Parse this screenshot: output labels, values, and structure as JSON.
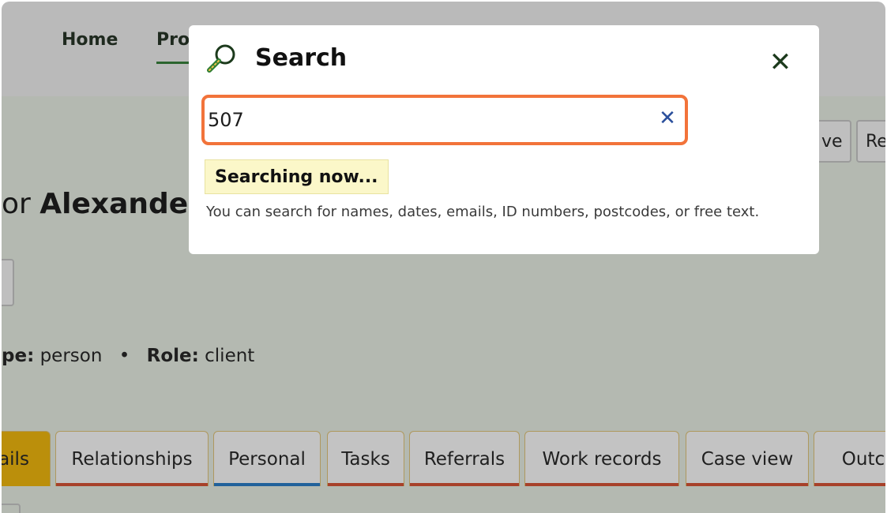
{
  "nav": {
    "items": [
      {
        "label": "Home"
      },
      {
        "label": "Pro"
      }
    ]
  },
  "header_buttons": [
    {
      "label": "ve"
    },
    {
      "label": "Re"
    }
  ],
  "page": {
    "title_prefix": "or",
    "title_name": "Alexander"
  },
  "meta": {
    "type_label": "pe:",
    "type_value": "person",
    "separator": "•",
    "role_label": "Role:",
    "role_value": "client"
  },
  "tabs": [
    {
      "label": "tails"
    },
    {
      "label": "Relationships"
    },
    {
      "label": "Personal"
    },
    {
      "label": "Tasks"
    },
    {
      "label": "Referrals"
    },
    {
      "label": "Work records"
    },
    {
      "label": "Case view"
    },
    {
      "label": "Outco"
    }
  ],
  "modal": {
    "title": "Search",
    "search_value": "507",
    "close_label": "✕",
    "clear_label": "✕",
    "status": "Searching now...",
    "help_text": "You can search for names, dates, emails, ID numbers, postcodes, or free text."
  },
  "icons": {
    "search": "search-icon",
    "close": "close-icon",
    "clear": "clear-icon"
  },
  "colors": {
    "accent_orange": "#f2733a",
    "active_tab": "#f4b800",
    "tab_underline_red": "#d94b2b",
    "tab_underline_blue": "#1f78c8",
    "nav_active": "#2e7d32",
    "clear_icon": "#2a4f9c"
  }
}
